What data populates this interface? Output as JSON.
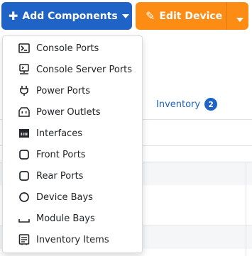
{
  "buttons": {
    "add_components": "Add Components",
    "edit_device": "Edit Device"
  },
  "tabs": {
    "inventory": {
      "label": "Inventory",
      "count": "2"
    }
  },
  "menu": {
    "items": [
      {
        "label": "Console Ports",
        "icon": "console-icon",
        "active": true
      },
      {
        "label": "Console Server Ports",
        "icon": "console-server-icon",
        "active": false
      },
      {
        "label": "Power Ports",
        "icon": "power-plug-icon",
        "active": false
      },
      {
        "label": "Power Outlets",
        "icon": "power-outlet-icon",
        "active": false
      },
      {
        "label": "Interfaces",
        "icon": "ethernet-icon",
        "active": false
      },
      {
        "label": "Front Ports",
        "icon": "square-rounded-icon",
        "active": false
      },
      {
        "label": "Rear Ports",
        "icon": "square-rounded-icon",
        "active": false
      },
      {
        "label": "Device Bays",
        "icon": "circle-icon",
        "active": false
      },
      {
        "label": "Module Bays",
        "icon": "tray-icon",
        "active": false
      },
      {
        "label": "Inventory Items",
        "icon": "list-box-icon",
        "active": false
      }
    ]
  },
  "colors": {
    "primary": "#1f63c6",
    "warning": "#fd8c14",
    "active_item": "#6c757d"
  }
}
